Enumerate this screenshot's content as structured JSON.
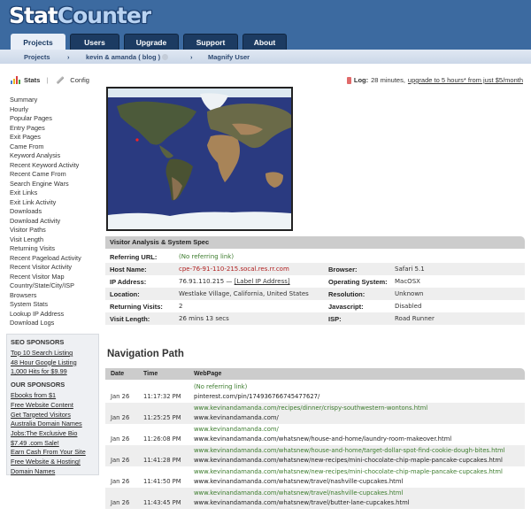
{
  "logo": {
    "part1": "Stat",
    "part2": "Counter"
  },
  "tabs": [
    {
      "label": "Projects",
      "active": true
    },
    {
      "label": "Users",
      "active": false
    },
    {
      "label": "Upgrade",
      "active": false
    },
    {
      "label": "Support",
      "active": false
    },
    {
      "label": "About",
      "active": false
    }
  ],
  "breadcrumb": {
    "root": "Projects",
    "sep": "›",
    "project": "kevin & amanda ( blog )",
    "current": "Magnify User"
  },
  "toolbar": {
    "stats": "Stats",
    "divider": "|",
    "config": "Config"
  },
  "log": {
    "label": "Log:",
    "text": "28 minutes,",
    "upgrade_link": "upgrade to 5 hours* from just $5/month"
  },
  "sidebar": {
    "items": [
      "Summary",
      "Hourly",
      "Popular Pages",
      "Entry Pages",
      "Exit Pages",
      "Came From",
      "Keyword Analysis",
      "Recent Keyword Activity",
      "Recent Came From",
      "Search Engine Wars",
      "Exit Links",
      "Exit Link Activity",
      "Downloads",
      "Download Activity",
      "Visitor Paths",
      "Visit Length",
      "Returning Visits",
      "Recent Pageload Activity",
      "Recent Visitor Activity",
      "Recent Visitor Map",
      "Country/State/City/ISP",
      "Browsers",
      "System Stats",
      "Lookup IP Address",
      "Download Logs"
    ]
  },
  "sponsors": {
    "seo_title": "SEO SPONSORS",
    "seo": [
      "Top 10 Search Listing",
      "48 Hour Google Listing",
      "1,000 Hits for $9.99"
    ],
    "our_title": "OUR SPONSORS",
    "our": [
      "Ebooks from $1",
      "Free Website Content",
      "Get Targeted Visitors",
      "Australia Domain Names",
      "Jobs:The Exclusive Bio",
      "$7.49 .com Sale!",
      "Earn Cash From Your Site",
      "Free Website & Hosting!",
      "Domain Names"
    ]
  },
  "visitor": {
    "title": "Visitor Analysis & System Spec",
    "referring_label": "Referring URL:",
    "referring_value": "(No referring link)",
    "host_label": "Host Name:",
    "host_value": "cpe-76-91-110-215.socal.res.rr.com",
    "browser_label": "Browser:",
    "browser_value": "Safari 5.1",
    "ip_label": "IP Address:",
    "ip_value": "76.91.110.215 —",
    "ip_link": "[Label IP Address]",
    "os_label": "Operating System:",
    "os_value": "MacOSX",
    "location_label": "Location:",
    "location_value": "Westlake Village, California, United States",
    "resolution_label": "Resolution:",
    "resolution_value": "Unknown",
    "returning_label": "Returning Visits:",
    "returning_value": "2",
    "js_label": "Javascript:",
    "js_value": "Disabled",
    "length_label": "Visit Length:",
    "length_value": "26 mins 13 secs",
    "isp_label": "ISP:",
    "isp_value": "Road Runner"
  },
  "navigation": {
    "title": "Navigation Path",
    "headers": {
      "date": "Date",
      "time": "Time",
      "page": "WebPage"
    },
    "rows": [
      {
        "date": "Jan 26",
        "time": "11:17:32 PM",
        "from": "(No referring link)",
        "page": "pinterest.com/pin/174936766745477627/"
      },
      {
        "date": "Jan 26",
        "time": "11:25:25 PM",
        "from": "www.kevinandamanda.com/recipes/dinner/crispy-southwestern-wontons.html",
        "page": "www.kevinandamanda.com/"
      },
      {
        "date": "Jan 26",
        "time": "11:26:08 PM",
        "from": "www.kevinandamanda.com/",
        "page": "www.kevinandamanda.com/whatsnew/house-and-home/laundry-room-makeover.html"
      },
      {
        "date": "Jan 26",
        "time": "11:41:28 PM",
        "from": "www.kevinandamanda.com/whatsnew/house-and-home/target-dollar-spot-find-cookie-dough-bites.html",
        "page": "www.kevinandamanda.com/whatsnew/new-recipes/mini-chocolate-chip-maple-pancake-cupcakes.html"
      },
      {
        "date": "Jan 26",
        "time": "11:41:50 PM",
        "from": "www.kevinandamanda.com/whatsnew/new-recipes/mini-chocolate-chip-maple-pancake-cupcakes.html",
        "page": "www.kevinandamanda.com/whatsnew/travel/nashville-cupcakes.html"
      },
      {
        "date": "Jan 26",
        "time": "11:43:45 PM",
        "from": "www.kevinandamanda.com/whatsnew/travel/nashville-cupcakes.html",
        "page": "www.kevinandamanda.com/whatsnew/travel/butter-lane-cupcakes.html"
      }
    ]
  }
}
